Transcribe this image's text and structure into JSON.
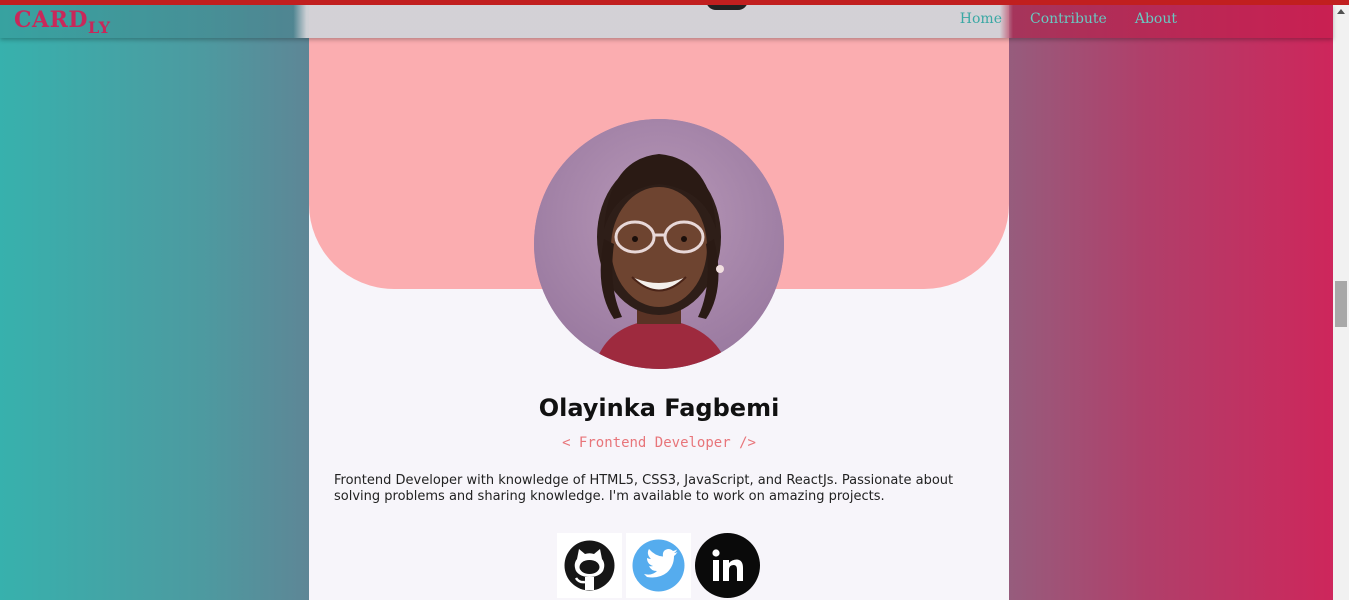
{
  "nav": {
    "logo_main": "CARD",
    "logo_sub": "LY",
    "links": [
      "Home",
      "Contribute",
      "About"
    ]
  },
  "profile": {
    "name": "Olayinka Fagbemi",
    "role": "< Frontend Developer />",
    "bio": "Frontend Developer with knowledge of HTML5, CSS3, JavaScript, and ReactJs. Passionate about solving problems and sharing knowledge. I'm available to work on amazing projects."
  },
  "socials": [
    {
      "icon": "github-icon"
    },
    {
      "icon": "twitter-icon"
    },
    {
      "icon": "linkedin-icon"
    }
  ],
  "colors": {
    "brand": "#c8285a",
    "header_pink": "#fbadb0",
    "role_text": "#e8757a",
    "nav_link": "#3aa8a4"
  }
}
